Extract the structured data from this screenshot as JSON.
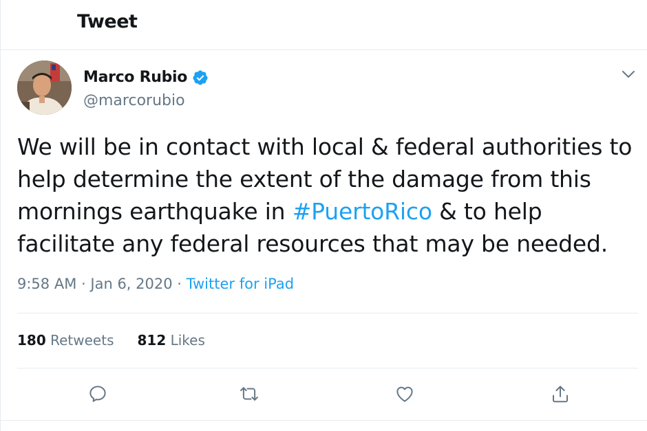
{
  "header": {
    "title": "Tweet"
  },
  "author": {
    "display_name": "Marco Rubio",
    "handle": "@marcorubio",
    "verified": true
  },
  "tweet": {
    "text_before": "We will be in contact with local & federal authorities to help determine the extent of the damage from this mornings earthquake in ",
    "hashtag": "#PuertoRico",
    "text_after": " & to help facilitate any federal resources that may be needed.",
    "time": "9:58 AM",
    "date": "Jan 6, 2020",
    "separator": "·",
    "source": "Twitter for iPad"
  },
  "stats": {
    "retweets_count": "180",
    "retweets_label": "Retweets",
    "likes_count": "812",
    "likes_label": "Likes"
  },
  "icons": {
    "reply": "reply-icon",
    "retweet": "retweet-icon",
    "like": "heart-icon",
    "share": "share-icon",
    "more": "chevron-down-icon",
    "verified": "verified-badge-icon"
  },
  "colors": {
    "accent": "#1da1f2",
    "secondary_text": "#657786",
    "primary_text": "#14171a",
    "border": "#e6ecf0"
  }
}
